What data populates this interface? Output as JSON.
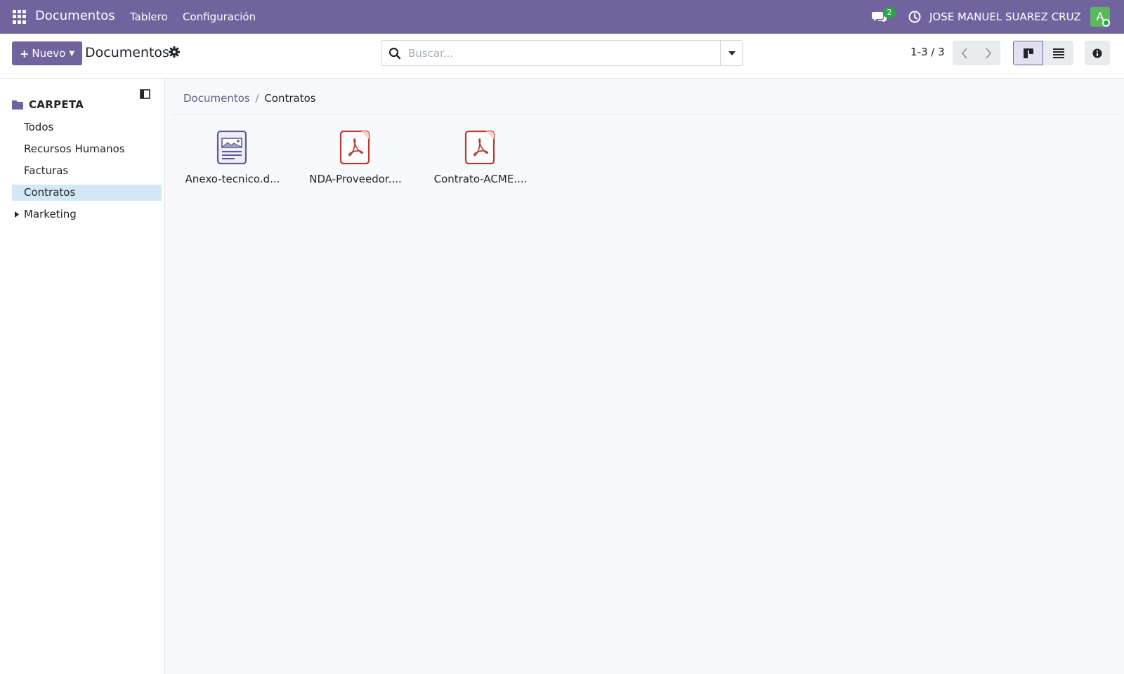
{
  "navbar": {
    "brand": "Documentos",
    "menu": [
      "Tablero",
      "Configuración"
    ],
    "chat_count": "2",
    "user_name": "JOSE MANUEL SUAREZ CRUZ",
    "avatar_initial": "A",
    "bg_color": "#71639e"
  },
  "control_panel": {
    "new_button_label": "Nuevo",
    "title": "Documentos",
    "search_placeholder": "Buscar...",
    "pager_value": "1-3 / 3"
  },
  "sidebar": {
    "header": "CARPETA",
    "items": [
      {
        "label": "Todos",
        "active": false
      },
      {
        "label": "Recursos Humanos",
        "active": false
      },
      {
        "label": "Facturas",
        "active": false
      },
      {
        "label": "Contratos",
        "active": true
      },
      {
        "label": "Marketing",
        "active": false,
        "expandable": true
      }
    ]
  },
  "breadcrumb": {
    "parent": "Documentos",
    "separator": "/",
    "current": "Contratos"
  },
  "documents": [
    {
      "name": "Anexo-tecnico.d...",
      "icon": "image-document-icon"
    },
    {
      "name": "NDA-Proveedor....",
      "icon": "pdf-icon"
    },
    {
      "name": "Contrato-ACME....",
      "icon": "pdf-icon"
    }
  ],
  "colors": {
    "accent": "#71639e",
    "active_folder_bg": "#d3e8f6",
    "pdf_red": "#c0392b"
  }
}
